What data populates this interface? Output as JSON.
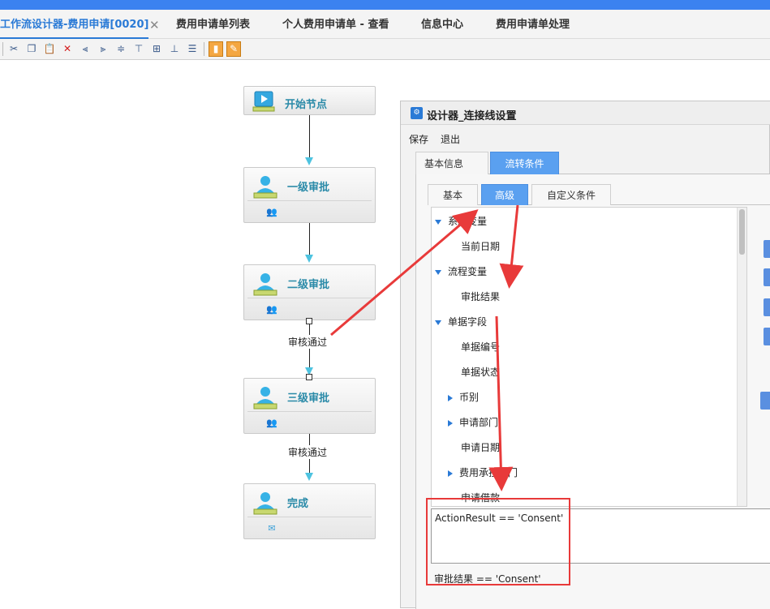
{
  "tabs": [
    {
      "label": "工作流设计器-费用申请[0020]",
      "active": true
    },
    {
      "label": "费用申请单列表",
      "active": false
    },
    {
      "label": "个人费用申请单 - 查看",
      "active": false
    },
    {
      "label": "信息中心",
      "active": false
    },
    {
      "label": "费用申请单处理",
      "active": false
    }
  ],
  "tab_close": "✕",
  "toolbar": {
    "icons": [
      "cut-icon",
      "copy-icon",
      "paste-icon",
      "delete-icon",
      "align-left-icon",
      "align-right-icon",
      "align-center-icon",
      "align-top-icon",
      "align-middle-icon",
      "align-bottom-icon",
      "align-justify-icon",
      "save-icon",
      "settings-icon"
    ]
  },
  "flow": {
    "nodes": [
      {
        "label": "开始节点"
      },
      {
        "label": "一级审批"
      },
      {
        "label": "二级审批"
      },
      {
        "label": "三级审批"
      },
      {
        "label": "完成"
      }
    ],
    "edge_labels": [
      "审核通过",
      "审核通过"
    ]
  },
  "dialog": {
    "title": "设计器_连接线设置",
    "menu": {
      "save": "保存",
      "exit": "退出"
    },
    "outer_tabs": [
      {
        "label": "基本信息",
        "active": false
      },
      {
        "label": "流转条件",
        "active": true
      }
    ],
    "inner_tabs": [
      {
        "label": "基本",
        "active": false
      },
      {
        "label": "高级",
        "active": true
      },
      {
        "label": "自定义条件",
        "active": false
      }
    ],
    "tree": [
      {
        "label": "系统变量",
        "expanded": true,
        "level": 0
      },
      {
        "label": "当前日期",
        "level": 1
      },
      {
        "label": "流程变量",
        "expanded": true,
        "level": 0
      },
      {
        "label": "审批结果",
        "level": 1
      },
      {
        "label": "单据字段",
        "expanded": true,
        "level": 0
      },
      {
        "label": "单据编号",
        "level": 1
      },
      {
        "label": "单据状态",
        "level": 1
      },
      {
        "label": "币别",
        "expanded": false,
        "level": 1
      },
      {
        "label": "申请部门",
        "expanded": false,
        "level": 1
      },
      {
        "label": "申请日期",
        "level": 1
      },
      {
        "label": "费用承担部门",
        "expanded": false,
        "level": 1
      },
      {
        "label": "申请借款",
        "level": 1
      }
    ],
    "expression": "ActionResult == 'Consent'",
    "expression_display": "审批结果 == 'Consent'"
  },
  "colors": {
    "accent": "#2a7ad6",
    "tab_active": "#5aa0f0",
    "annotation": "#e83a3a",
    "node_label": "#2a8aa8"
  }
}
